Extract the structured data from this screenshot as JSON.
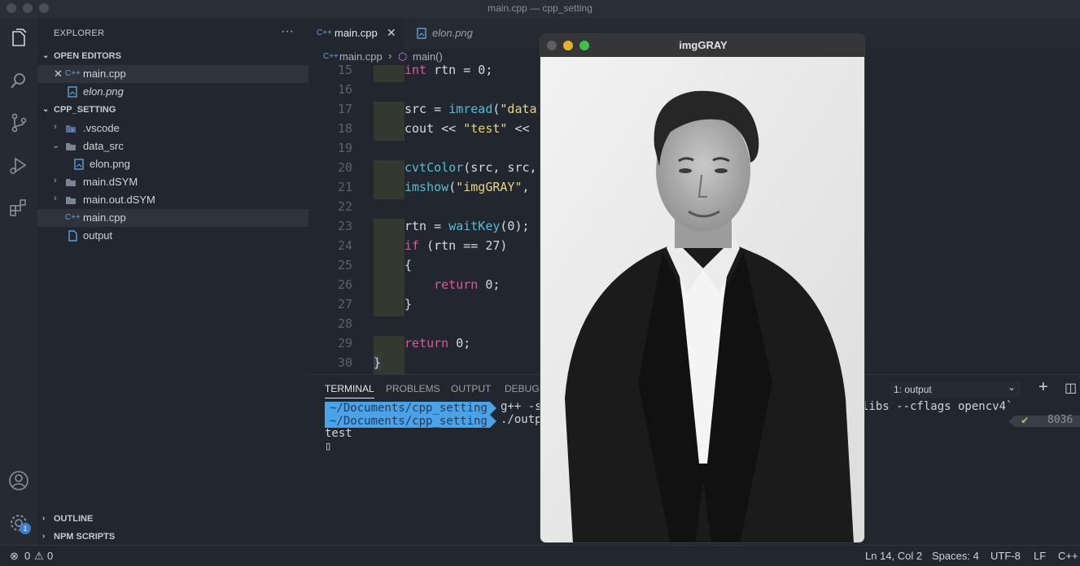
{
  "window": {
    "title": "main.cpp — cpp_setting"
  },
  "activity_bar": {
    "icons": [
      "files-icon",
      "search-icon",
      "source-control-icon",
      "run-debug-icon",
      "extensions-icon",
      "account-icon",
      "settings-gear-icon"
    ],
    "settings_badge": "1"
  },
  "sidebar": {
    "title": "EXPLORER",
    "more": "···",
    "open_editors_label": "OPEN EDITORS",
    "open_editors": [
      {
        "close": "✕",
        "icon": "C++",
        "name": "main.cpp"
      },
      {
        "name": "elon.png"
      }
    ],
    "project_label": "CPP_SETTING",
    "tree": [
      {
        "name": ".vscode",
        "chevron": "›"
      },
      {
        "name": "data_src",
        "chevron": "⌄"
      },
      {
        "name": "elon.png"
      },
      {
        "name": "main.dSYM",
        "chevron": "›"
      },
      {
        "name": "main.out.dSYM",
        "chevron": "›"
      },
      {
        "name": "main.cpp",
        "icon": "C++"
      },
      {
        "name": "output"
      }
    ],
    "outline_label": "OUTLINE",
    "npm_label": "NPM SCRIPTS"
  },
  "tabs": [
    {
      "icon": "C++",
      "label": "main.cpp",
      "close": "✕"
    },
    {
      "label": "elon.png"
    }
  ],
  "breadcrumb": {
    "icon": "C++",
    "file": "main.cpp",
    "sep": "›",
    "symbol": "main()"
  },
  "editor": {
    "lines": [
      {
        "n": "15",
        "code": [
          [
            "k",
            "int"
          ],
          [
            "n",
            " rtn = 0;"
          ]
        ]
      },
      {
        "n": "16",
        "code": []
      },
      {
        "n": "17",
        "code": [
          [
            "n",
            "src = "
          ],
          [
            "f",
            "imread"
          ],
          [
            "n",
            "("
          ],
          [
            "s",
            "\"data"
          ]
        ]
      },
      {
        "n": "18",
        "code": [
          [
            "n",
            "cout << "
          ],
          [
            "s",
            "\"test\""
          ],
          [
            "n",
            " <<"
          ]
        ]
      },
      {
        "n": "19",
        "code": []
      },
      {
        "n": "20",
        "code": [
          [
            "f",
            "cvtColor"
          ],
          [
            "n",
            "(src, src,"
          ]
        ]
      },
      {
        "n": "21",
        "code": [
          [
            "f",
            "imshow"
          ],
          [
            "n",
            "("
          ],
          [
            "s",
            "\"imgGRAY\""
          ],
          [
            "n",
            ","
          ]
        ]
      },
      {
        "n": "22",
        "code": []
      },
      {
        "n": "23",
        "code": [
          [
            "n",
            "rtn = "
          ],
          [
            "f",
            "waitKey"
          ],
          [
            "n",
            "(0);"
          ]
        ]
      },
      {
        "n": "24",
        "code": [
          [
            "k",
            "if"
          ],
          [
            "n",
            " (rtn == 27)"
          ]
        ]
      },
      {
        "n": "25",
        "code": [
          [
            "n",
            "{"
          ]
        ]
      },
      {
        "n": "26",
        "code": [
          [
            "k",
            "    return"
          ],
          [
            "n",
            " 0;"
          ]
        ]
      },
      {
        "n": "27",
        "code": [
          [
            "n",
            "}"
          ]
        ]
      },
      {
        "n": "28",
        "code": []
      },
      {
        "n": "29",
        "code": [
          [
            "k",
            "return"
          ],
          [
            "n",
            " 0;"
          ]
        ]
      },
      {
        "n": "30",
        "code": [
          [
            "n",
            "}"
          ]
        ]
      }
    ]
  },
  "panel": {
    "tabs": [
      "TERMINAL",
      "PROBLEMS",
      "OUTPUT",
      "DEBUG"
    ],
    "select_value": "1: output",
    "select_chevron": "⌄",
    "add": "+",
    "split": "◫",
    "prompt_path": "~/Documents/cpp_setting",
    "cmd1": "g++ -s",
    "cmd1_tail": "libs --cflags opencv4`",
    "cmd2": "./outp",
    "output": "test",
    "cursor": "▯",
    "check": "✔",
    "pid": "8036"
  },
  "status": {
    "errors": "0",
    "warnings": "0",
    "position": "Ln 14, Col 2",
    "spaces": "Spaces: 4",
    "encoding": "UTF-8",
    "eol": "LF",
    "language": "C++"
  },
  "image_window": {
    "title": "imgGRAY"
  },
  "colors": {
    "accent": "#4aa3e8",
    "keyword": "#d25d9b",
    "function": "#4fc0d4",
    "string": "#e8d67a"
  }
}
